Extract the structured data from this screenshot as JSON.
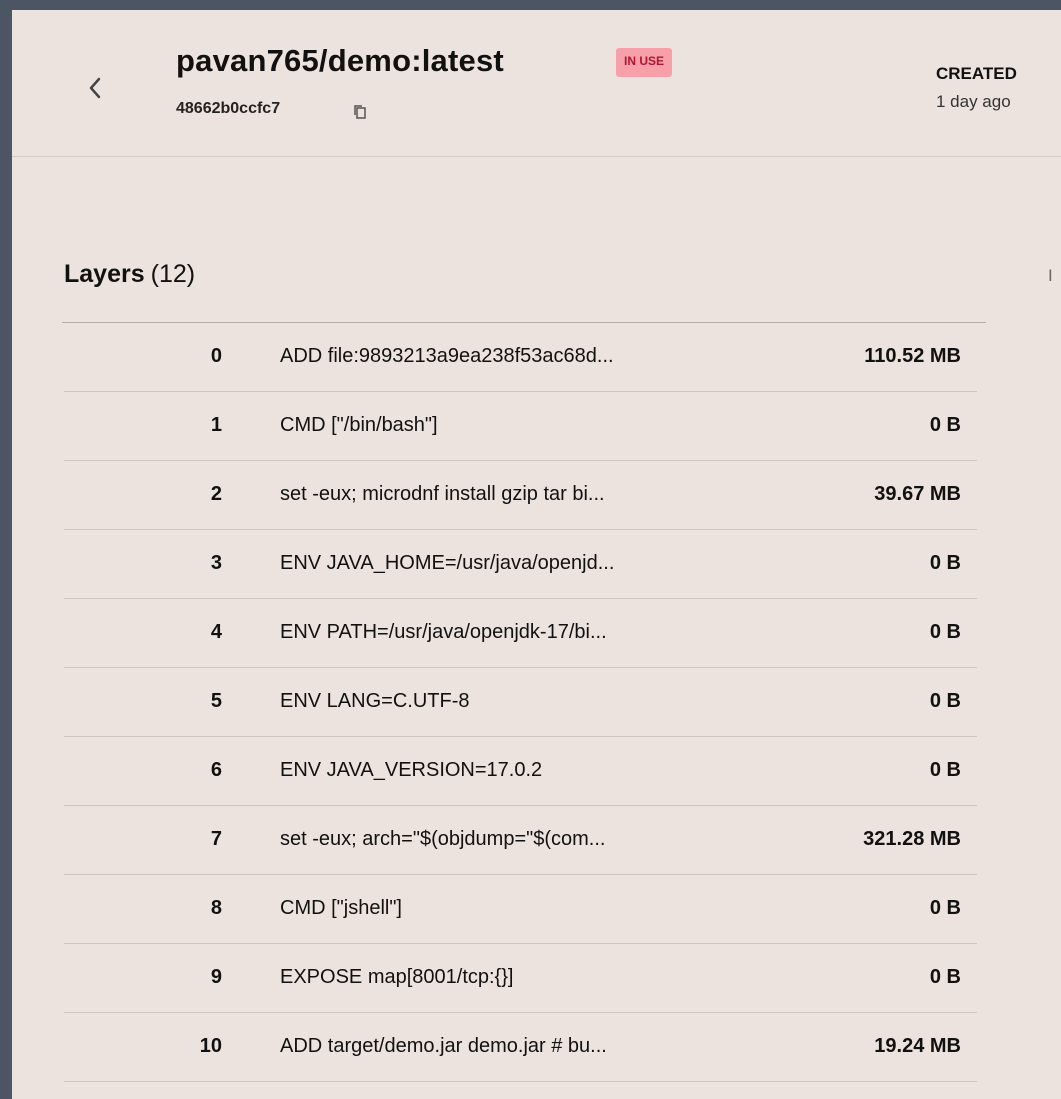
{
  "image": {
    "title": "pavan765/demo:latest",
    "status_badge": "IN USE",
    "short_id": "48662b0ccfc7",
    "created_label": "CREATED",
    "created_value": "1 day ago"
  },
  "layers": {
    "title": "Layers",
    "count_text": "(12)",
    "right_tab_fragment": "I",
    "rows": [
      {
        "index": "0",
        "command": "ADD file:9893213a9ea238f53ac68d...",
        "size": "110.52 MB"
      },
      {
        "index": "1",
        "command": "CMD [\"/bin/bash\"]",
        "size": "0 B"
      },
      {
        "index": "2",
        "command": "set -eux; microdnf install gzip tar bi...",
        "size": "39.67 MB"
      },
      {
        "index": "3",
        "command": "ENV JAVA_HOME=/usr/java/openjd...",
        "size": "0 B"
      },
      {
        "index": "4",
        "command": "ENV PATH=/usr/java/openjdk-17/bi...",
        "size": "0 B"
      },
      {
        "index": "5",
        "command": "ENV LANG=C.UTF-8",
        "size": "0 B"
      },
      {
        "index": "6",
        "command": "ENV JAVA_VERSION=17.0.2",
        "size": "0 B"
      },
      {
        "index": "7",
        "command": "set -eux; arch=\"$(objdump=\"$(com...",
        "size": "321.28 MB"
      },
      {
        "index": "8",
        "command": "CMD [\"jshell\"]",
        "size": "0 B"
      },
      {
        "index": "9",
        "command": "EXPOSE map[8001/tcp:{}]",
        "size": "0 B"
      },
      {
        "index": "10",
        "command": "ADD target/demo.jar demo.jar # bu...",
        "size": "19.24 MB"
      }
    ]
  },
  "icons": {
    "back": "chevron-left-icon",
    "copy": "copy-icon"
  },
  "colors": {
    "badge_background": "#f7a0aa",
    "badge_text": "#b01630",
    "panel_background": "#ece3df",
    "outer_background": "#4b5563"
  }
}
